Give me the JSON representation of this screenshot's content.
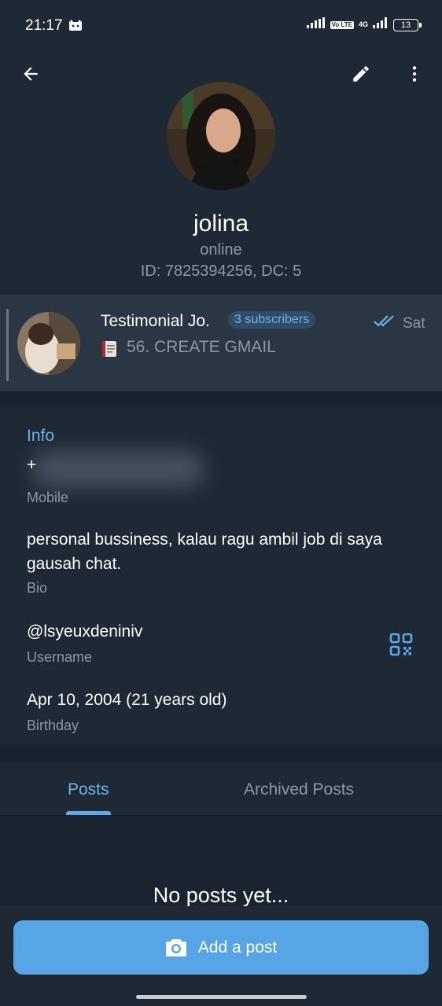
{
  "status_bar": {
    "time": "21:17",
    "volte": "Vo LTE",
    "network": "4G",
    "battery": "13",
    "icons": [
      "cat-notification-icon",
      "signal-icon",
      "volte-icon",
      "signal-4g-icon",
      "battery-icon"
    ]
  },
  "toolbar": {
    "back_icon": "arrow-left-icon",
    "edit_icon": "pencil-icon",
    "more_icon": "more-vertical-icon"
  },
  "profile": {
    "name": "jolina",
    "status": "online",
    "id_line": "ID: 7825394256, DC: 5"
  },
  "channel": {
    "name": "Testimonial Jo.",
    "subscribers": "3 subscribers",
    "date": "Sat",
    "message": "56. CREATE GMAIL"
  },
  "info": {
    "title": "Info",
    "phone_prefix": "+",
    "phone_label": "Mobile",
    "bio": "personal bussiness, kalau ragu ambil job di saya gausah chat.",
    "bio_label": "Bio",
    "username": "@lsyeuxdeniniv",
    "username_label": "Username",
    "birthday": "Apr 10, 2004 (21 years old)",
    "birthday_label": "Birthday"
  },
  "tabs": {
    "posts": "Posts",
    "archived": "Archived Posts"
  },
  "posts": {
    "empty_title": "No posts yet...",
    "add_label": "Add a post"
  },
  "colors": {
    "background": "#1f2936",
    "accent": "#6cb3ec",
    "button": "#58a5e6",
    "muted_text": "#8d98a5"
  }
}
